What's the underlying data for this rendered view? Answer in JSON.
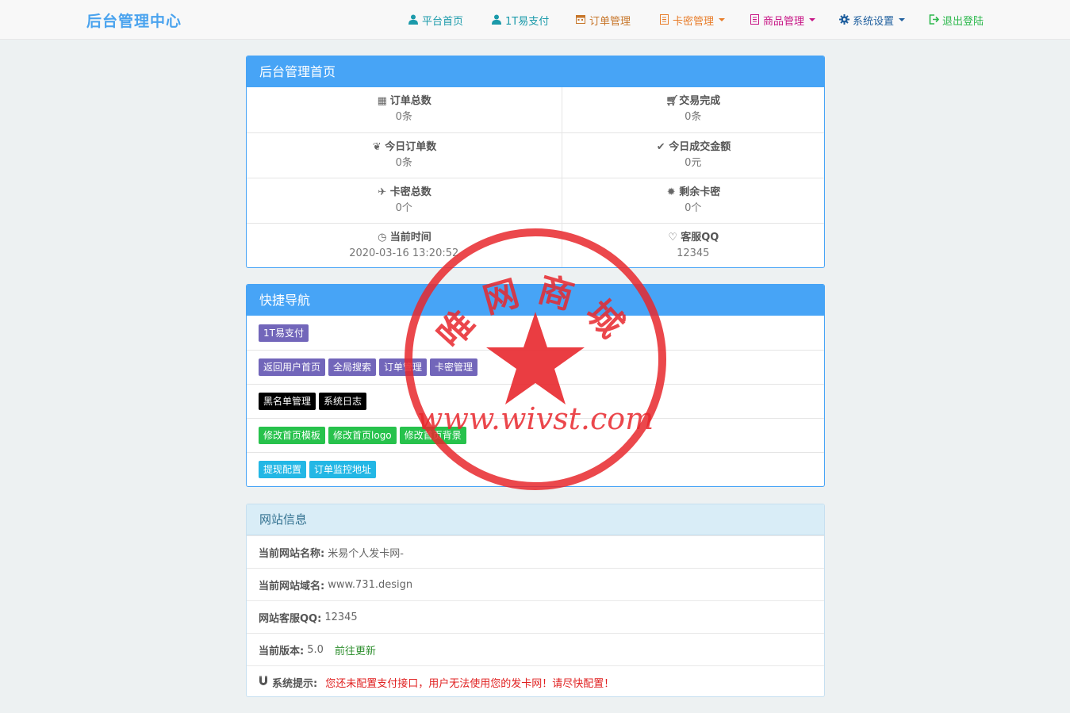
{
  "brand": "后台管理中心",
  "nav": [
    {
      "label": "平台首页",
      "icon": "user-icon",
      "color": "#1b9aaa"
    },
    {
      "label": "1T易支付",
      "icon": "user-icon",
      "color": "#1b9aaa"
    },
    {
      "label": "订单管理",
      "icon": "calendar-icon",
      "color": "#c7762a"
    },
    {
      "label": "卡密管理",
      "icon": "list-icon",
      "color": "#e87d2a"
    },
    {
      "label": "商品管理",
      "icon": "list-icon",
      "color": "#c71585"
    },
    {
      "label": "系统设置",
      "icon": "gear-icon",
      "color": "#1f5f9e"
    },
    {
      "label": "退出登陆",
      "icon": "logout-icon",
      "color": "#2db84d"
    }
  ],
  "dashboard": {
    "title": "后台管理首页",
    "stats": [
      {
        "label": "订单总数",
        "value": "0条",
        "icon": "grid-icon"
      },
      {
        "label": "交易完成",
        "value": "0条",
        "icon": "cart-icon"
      },
      {
        "label": "今日订单数",
        "value": "0条",
        "icon": "leaf-icon"
      },
      {
        "label": "今日成交金额",
        "value": "0元",
        "icon": "check-icon"
      },
      {
        "label": "卡密总数",
        "value": "0个",
        "icon": "plane-icon"
      },
      {
        "label": "剩余卡密",
        "value": "0个",
        "icon": "asterisk-icon"
      },
      {
        "label": "当前时间",
        "value": "2020-03-16 13:20:52",
        "icon": "clock-icon"
      },
      {
        "label": "客服QQ",
        "value": "12345",
        "icon": "heart-icon"
      }
    ]
  },
  "quicknav": {
    "title": "快捷导航",
    "rows": [
      [
        {
          "label": "1T易支付",
          "style": "purple"
        }
      ],
      [
        {
          "label": "返回用户首页",
          "style": "purple"
        },
        {
          "label": "全局搜索",
          "style": "purple"
        },
        {
          "label": "订单管理",
          "style": "purple"
        },
        {
          "label": "卡密管理",
          "style": "purple"
        }
      ],
      [
        {
          "label": "黑名单管理",
          "style": "black"
        },
        {
          "label": "系统日志",
          "style": "black"
        }
      ],
      [
        {
          "label": "修改首页模板",
          "style": "green"
        },
        {
          "label": "修改首页logo",
          "style": "green"
        },
        {
          "label": "修改首页背景",
          "style": "green"
        }
      ],
      [
        {
          "label": "提现配置",
          "style": "cyan"
        },
        {
          "label": "订单监控地址",
          "style": "cyan"
        }
      ]
    ]
  },
  "siteinfo": {
    "title": "网站信息",
    "name_key": "当前网站名称:",
    "name_val": "米易个人发卡网-",
    "domain_key": "当前网站域名:",
    "domain_val": "www.731.design",
    "qq_key": "网站客服QQ:",
    "qq_val": "12345",
    "version_key": "当前版本:",
    "version_val": "5.0",
    "update_link": "前往更新",
    "notice_key": "系统提示:",
    "notice_val": "您还未配置支付接口，用户无法使用您的发卡网！请尽快配置！"
  },
  "watermark": {
    "text_top": "唯网商城",
    "text_bottom": "www.wivst.com",
    "color": "#e8282d"
  }
}
